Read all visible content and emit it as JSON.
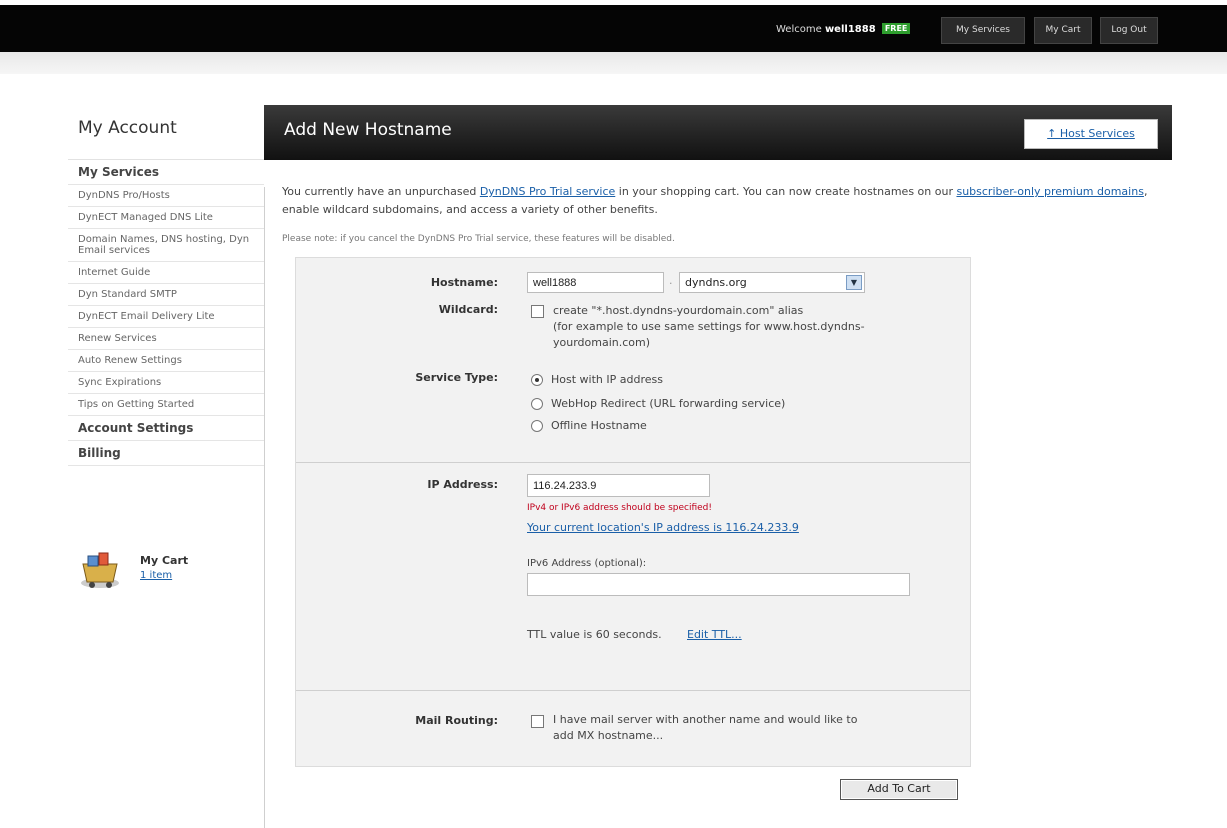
{
  "topbar": {
    "welcome_prefix": "Welcome",
    "username": "well1888",
    "badge": "FREE",
    "buttons": [
      "My Services",
      "My Cart",
      "Log Out"
    ]
  },
  "sidebar": {
    "title": "My Account",
    "items": [
      {
        "label": "My Services",
        "bold": true
      },
      {
        "label": "DynDNS Pro/Hosts",
        "bold": false
      },
      {
        "label": "DynECT Managed DNS Lite",
        "bold": false
      },
      {
        "label": "Domain Names, DNS hosting, Dyn Email services",
        "bold": false
      },
      {
        "label": "Internet Guide",
        "bold": false
      },
      {
        "label": "Dyn Standard SMTP",
        "bold": false
      },
      {
        "label": "DynECT Email Delivery Lite",
        "bold": false
      },
      {
        "label": "Renew Services",
        "bold": false
      },
      {
        "label": "Auto Renew Settings",
        "bold": false
      },
      {
        "label": "Sync Expirations",
        "bold": false
      },
      {
        "label": "Tips on Getting Started",
        "bold": false
      },
      {
        "label": "Account Settings",
        "bold": true
      },
      {
        "label": "Billing",
        "bold": true
      }
    ],
    "cart": {
      "label": "My Cart",
      "items": "1 item"
    }
  },
  "main": {
    "title": "Add New Hostname",
    "host_services_link": "↑ Host Services",
    "intro_1": "You currently have an unpurchased ",
    "intro_link1": "DynDNS Pro Trial service",
    "intro_2": " in your shopping cart. You can now create hostnames on our ",
    "intro_link2": "subscriber-only premium domains",
    "intro_3": ", enable wildcard subdomains, and access a variety of other benefits.",
    "note": "Please note: if you cancel the DynDNS Pro Trial service, these features will be disabled."
  },
  "form": {
    "hostname_label": "Hostname:",
    "hostname_value": "well1888",
    "domain_sep": "·",
    "domain_value": "dyndns.org",
    "wildcard_label": "Wildcard:",
    "wildcard_text_1": "create \"*.host.dyndns-yourdomain.com\" alias",
    "wildcard_text_2": "(for example to use same settings for www.host.dyndns-",
    "wildcard_text_3": "yourdomain.com)",
    "service_type_label": "Service Type:",
    "service_options": [
      "Host with IP address",
      "WebHop Redirect (URL forwarding service)",
      "Offline Hostname"
    ],
    "ip_label": "IP Address:",
    "ip_value": "116.24.233.9",
    "ip_error": "IPv4 or IPv6 address should be specified!",
    "ip_current_link": "Your current location's IP address is 116.24.233.9",
    "ipv6_label": "IPv6 Address (optional):",
    "ttl_text": "TTL value is 60 seconds.",
    "ttl_link": "Edit TTL...",
    "mail_label": "Mail Routing:",
    "mail_text_1": "I have mail server with another name and would like to",
    "mail_text_2": "add MX hostname..."
  },
  "actions": {
    "add_to_cart": "Add To Cart"
  },
  "colors": {
    "topbar": "#050505",
    "badge": "#2e9e2e",
    "link": "#1a5fa8",
    "error": "#c0001c",
    "panel": "#f2f2f2"
  }
}
